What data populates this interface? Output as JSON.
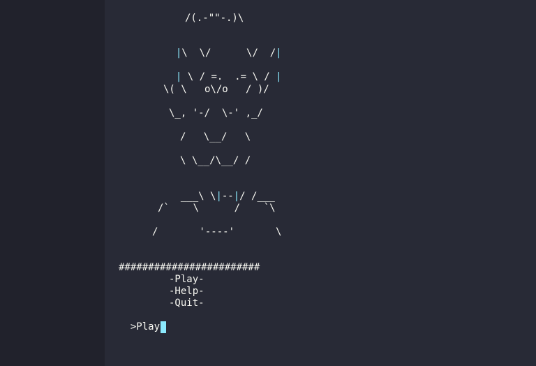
{
  "art": {
    "l1": "/(.-\"\"-.)\\",
    "l2a": "|",
    "l2b": "\\  \\/      \\/  /",
    "l2c": "|",
    "l3a": "|",
    "l3b": " \\ / =.  .= \\ / ",
    "l3c": "|",
    "l4": "\\( \\   o\\/o   / )/",
    "l5": "\\_, '-/  \\-' ,_/",
    "l6": "/   \\__/   \\",
    "l7": "\\ \\__/\\__/ /",
    "l8a": "___\\ \\",
    "l8b": "|",
    "l8c": "--",
    "l8d": "|",
    "l8e": "/ /___",
    "l9": "/`    \\      /    `\\",
    "l10": "/       '----'       \\"
  },
  "menu": {
    "border": "########################",
    "play": "-Play-",
    "help": "-Help-",
    "quit": "-Quit-"
  },
  "prompt": {
    "symbol": ">",
    "input": "Play"
  }
}
